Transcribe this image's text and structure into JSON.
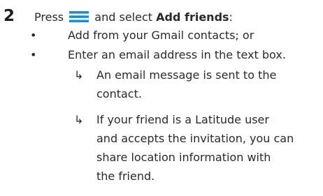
{
  "step": {
    "number": "2",
    "press_label": "Press",
    "and_select_label": "and select",
    "target": "Add friends",
    "colon": ":",
    "menu_icon": "menu-icon",
    "menu_icon_color": "#1a8fd6"
  },
  "options": [
    {
      "bullet": "•",
      "text": "Add from your Gmail contacts; or"
    },
    {
      "bullet": "•",
      "text": "Enter an email address in the text box."
    }
  ],
  "results": [
    {
      "arrow": "↳",
      "lines": [
        "An email message is sent to the",
        "contact."
      ]
    },
    {
      "arrow": "↳",
      "lines": [
        "If your friend is a Latitude user",
        "and accepts the invitation, you can",
        "share location information with",
        "the friend."
      ]
    }
  ]
}
